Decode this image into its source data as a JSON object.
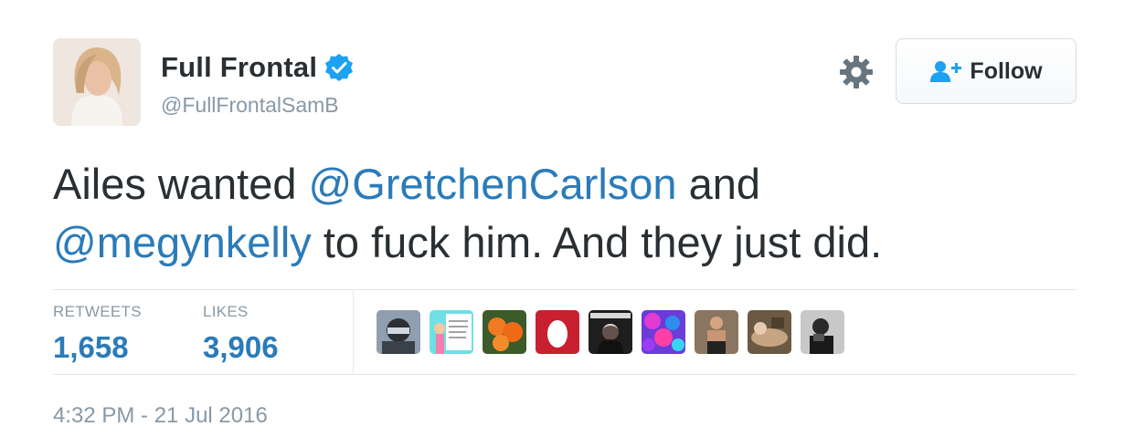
{
  "author": {
    "name": "Full Frontal",
    "handle": "@FullFrontalSamB",
    "verified": true
  },
  "follow_button": {
    "label": "Follow",
    "icon": "follow-user-icon"
  },
  "settings_icon": "gear-icon",
  "tweet": {
    "part1": "Ailes wanted ",
    "mention1": "@GretchenCarlson",
    "part2": " and ",
    "mention2": "@megynkelly",
    "part3": " to fuck him. And they just did."
  },
  "stats": {
    "retweets_label": "RETWEETS",
    "retweets_value": "1,658",
    "likes_label": "LIKES",
    "likes_value": "3,906"
  },
  "timestamp": "4:32 PM - 21 Jul 2016",
  "colors": {
    "link": "#2b7bb9",
    "text": "#292f33",
    "muted": "#8899a6",
    "verified": "#1da1f2"
  }
}
